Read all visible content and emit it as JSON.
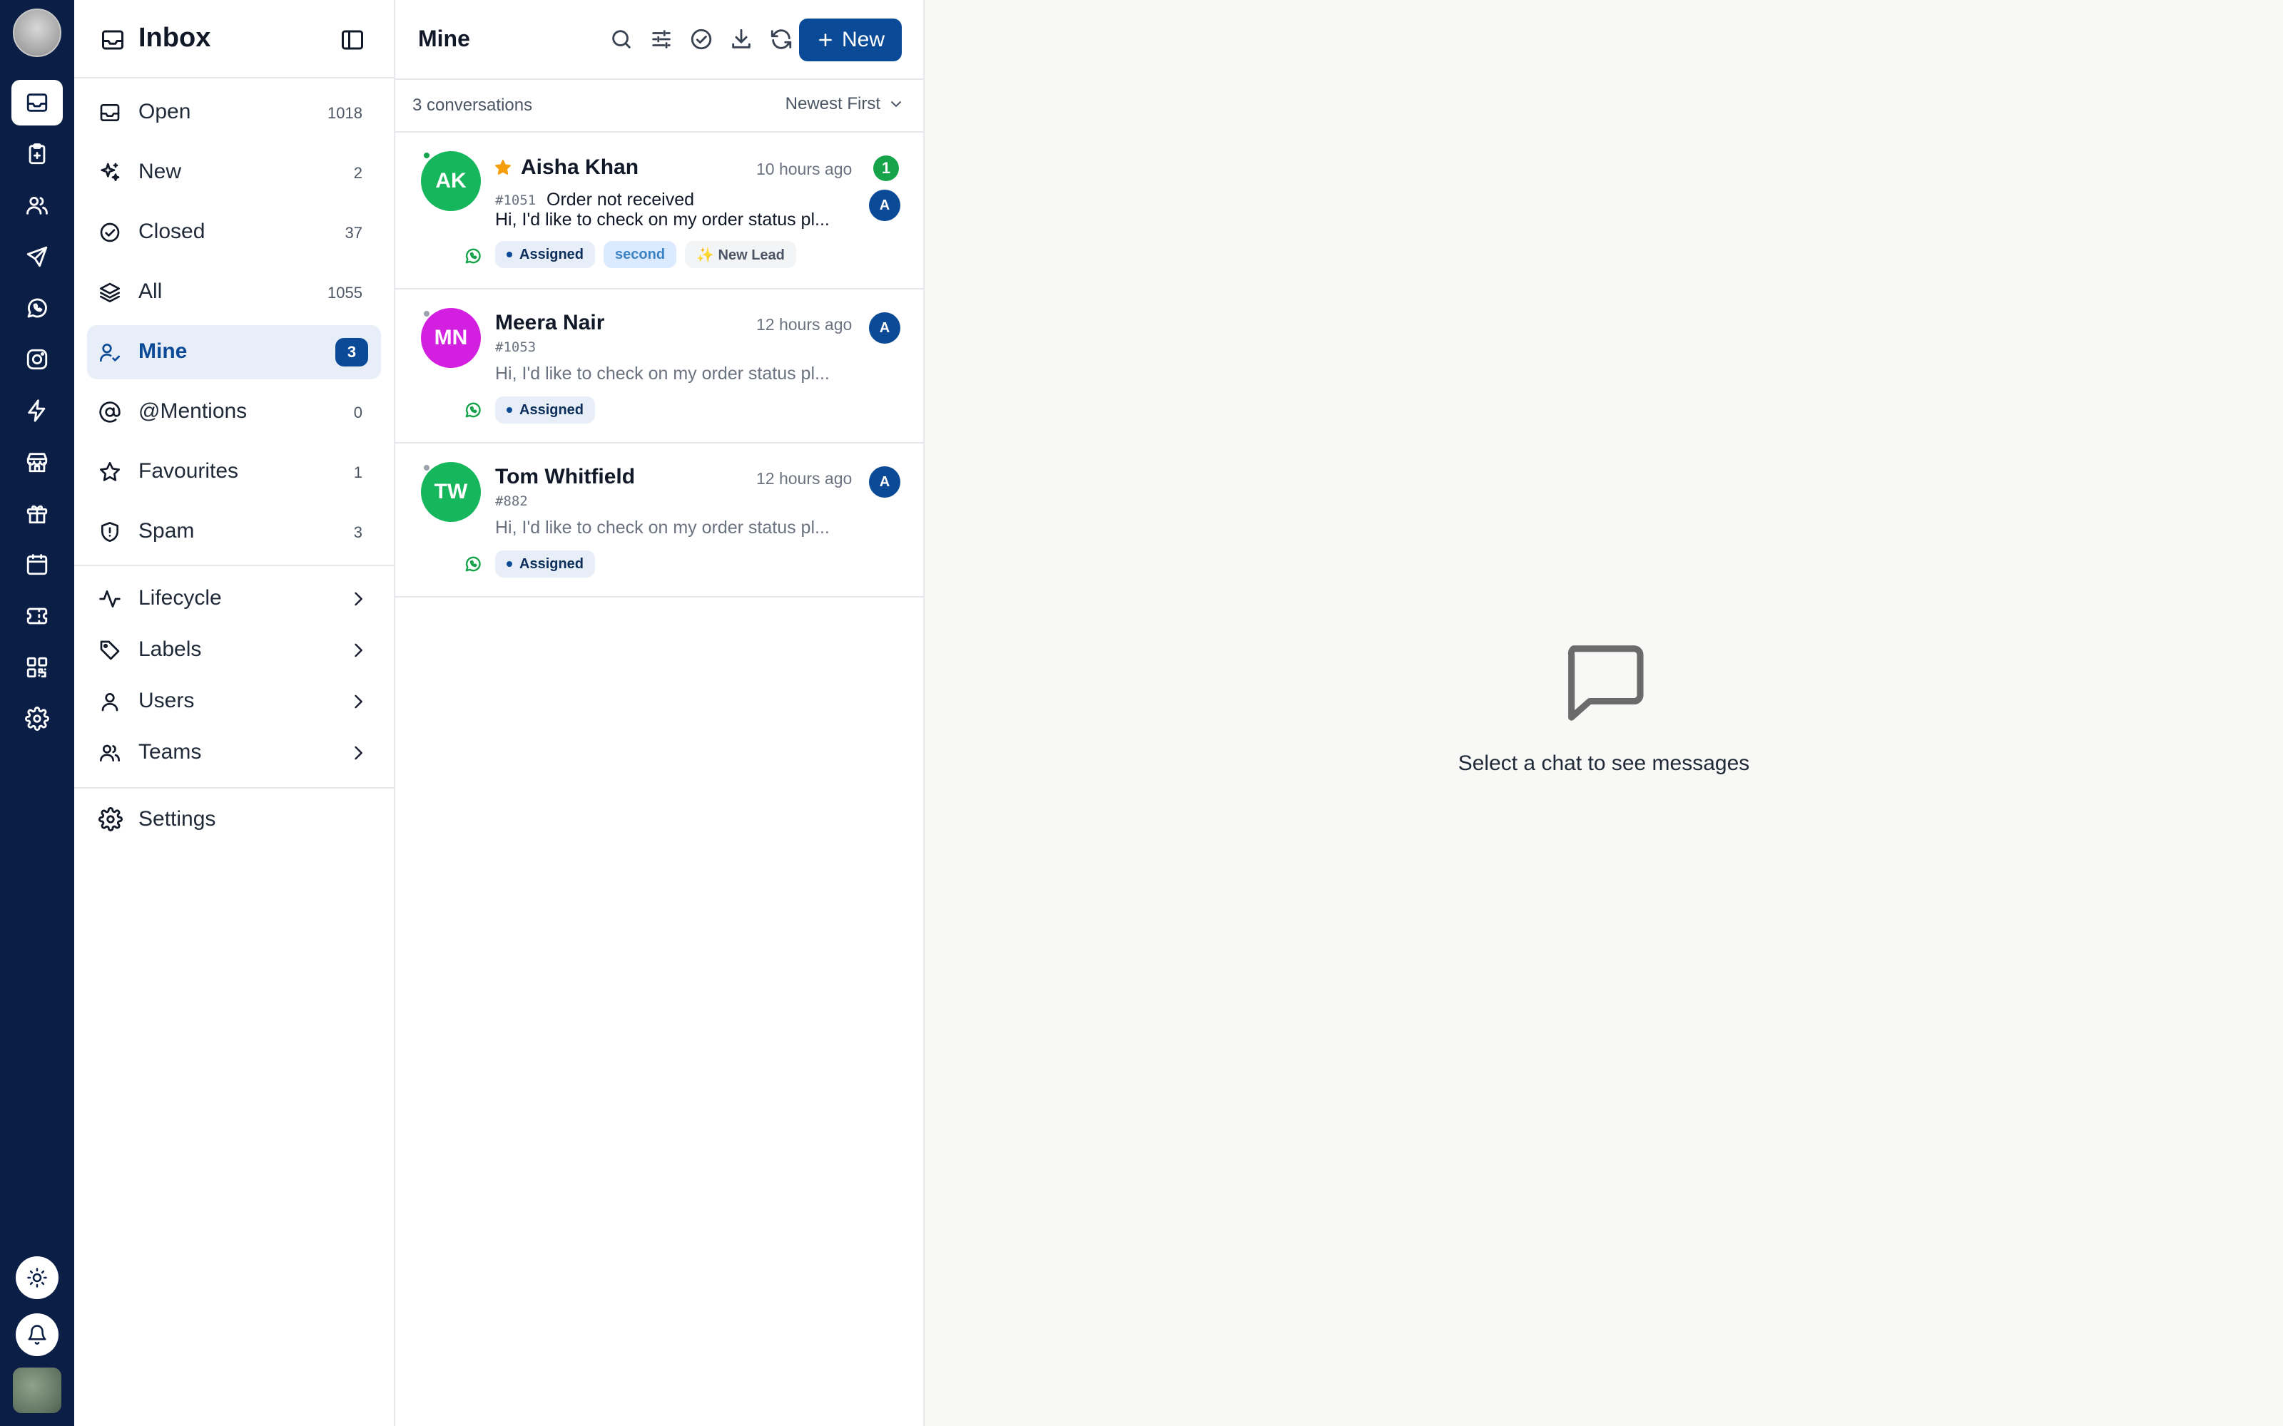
{
  "nav": {
    "title": "Inbox",
    "items": [
      {
        "label": "Open",
        "count": "1018"
      },
      {
        "label": "New",
        "count": "2"
      },
      {
        "label": "Closed",
        "count": "37"
      },
      {
        "label": "All",
        "count": "1055"
      },
      {
        "label": "Mine",
        "count": "3"
      },
      {
        "label": "@Mentions",
        "count": "0"
      },
      {
        "label": "Favourites",
        "count": "1"
      },
      {
        "label": "Spam",
        "count": "3"
      }
    ],
    "groups": [
      {
        "label": "Lifecycle"
      },
      {
        "label": "Labels"
      },
      {
        "label": "Users"
      },
      {
        "label": "Teams"
      }
    ],
    "settings_label": "Settings"
  },
  "list": {
    "title": "Mine",
    "new_label": "New",
    "count_text": "3 conversations",
    "sort_label": "Newest First",
    "conversations": [
      {
        "initials": "AK",
        "name": "Aisha Khan",
        "time": "10 hours ago",
        "ticket": "#1051",
        "subject": "Order not received",
        "preview": "Hi, I'd like to check on my order status pl...",
        "unread": "1",
        "agent": "A",
        "tags": [
          "Assigned",
          "second",
          "✨ New Lead"
        ]
      },
      {
        "initials": "MN",
        "name": "Meera Nair",
        "time": "12 hours ago",
        "ticket": "#1053",
        "preview": "Hi, I'd like to check on my order status pl...",
        "agent": "A",
        "tags": [
          "Assigned"
        ]
      },
      {
        "initials": "TW",
        "name": "Tom Whitfield",
        "time": "12 hours ago",
        "ticket": "#882",
        "preview": "Hi, I'd like to check on my order status pl...",
        "agent": "A",
        "tags": [
          "Assigned"
        ]
      }
    ]
  },
  "empty_state": {
    "message": "Select a chat to see messages"
  },
  "colors": {
    "rail": "#0b1e45",
    "accent": "#0b4a97",
    "avatar_green": "#16b65c",
    "avatar_magenta": "#d31fe0",
    "online": "#16a34a",
    "offline": "#9ca3af",
    "star": "#f59e0b"
  },
  "icons": {
    "rail": [
      "inbox-icon",
      "clipboard-icon",
      "users-icon",
      "send-icon",
      "whatsapp-icon",
      "instagram-icon",
      "zap-icon",
      "store-icon",
      "gift-icon",
      "calendar-icon",
      "ticket-icon",
      "qr-code-icon",
      "gear-icon"
    ],
    "toolbar": [
      "search-icon",
      "filter-icon",
      "check-circle-icon",
      "download-icon",
      "refresh-icon"
    ]
  }
}
